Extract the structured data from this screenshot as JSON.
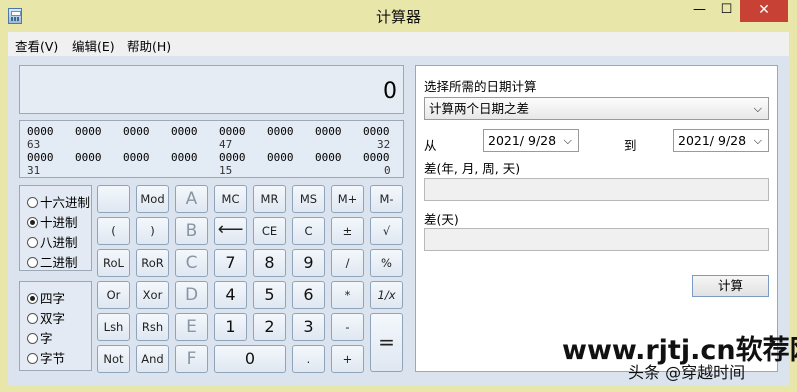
{
  "window": {
    "title": "计算器",
    "min_glyph": "—",
    "max_glyph": "☐",
    "close_glyph": "✕"
  },
  "menu": [
    "查看(V)",
    "编辑(E)",
    "帮助(H)"
  ],
  "display": {
    "value": "0"
  },
  "binary": {
    "row1": [
      "0000",
      "0000",
      "0000",
      "0000",
      "0000",
      "0000",
      "0000",
      "0000"
    ],
    "row1_marks": [
      "63",
      "47",
      "32"
    ],
    "row2": [
      "0000",
      "0000",
      "0000",
      "0000",
      "0000",
      "0000",
      "0000",
      "0000"
    ],
    "row2_marks": [
      "31",
      "15",
      "0"
    ]
  },
  "base_options": [
    "十六进制",
    "十进制",
    "八进制",
    "二进制"
  ],
  "base_selected": "十进制",
  "word_options": [
    "四字",
    "双字",
    "字",
    "字节"
  ],
  "word_selected": "四字",
  "keys": {
    "mod": "Mod",
    "A": "A",
    "MC": "MC",
    "MR": "MR",
    "MS": "MS",
    "Mplus": "M+",
    "Mminus": "M-",
    "lparen": "(",
    "rparen": ")",
    "B": "B",
    "back": "⟵",
    "CE": "CE",
    "C": "C",
    "pm": "±",
    "sqrt": "√",
    "RoL": "RoL",
    "RoR": "RoR",
    "Ckey": "C",
    "n7": "7",
    "n8": "8",
    "n9": "9",
    "div": "/",
    "pct": "%",
    "Or": "Or",
    "Xor": "Xor",
    "D": "D",
    "n4": "4",
    "n5": "5",
    "n6": "6",
    "mul": "*",
    "recip": "1/x",
    "Lsh": "Lsh",
    "Rsh": "Rsh",
    "E": "E",
    "n1": "1",
    "n2": "2",
    "n3": "3",
    "sub": "-",
    "eq": "=",
    "Not": "Not",
    "And": "And",
    "F": "F",
    "n0": "0",
    "dot": ".",
    "add": "+"
  },
  "date_panel": {
    "heading": "选择所需的日期计算",
    "mode": "计算两个日期之差",
    "from_label": "从",
    "from_date": "2021/ 9/28",
    "to_label": "到",
    "to_date": "2021/ 9/28",
    "diff_ymwd_label": "差(年, 月, 周, 天)",
    "diff_days_label": "差(天)",
    "calc_button": "计算"
  },
  "watermark": {
    "site": "www.rjtj.cn软荐网",
    "credit": "头条 @穿越时间"
  }
}
